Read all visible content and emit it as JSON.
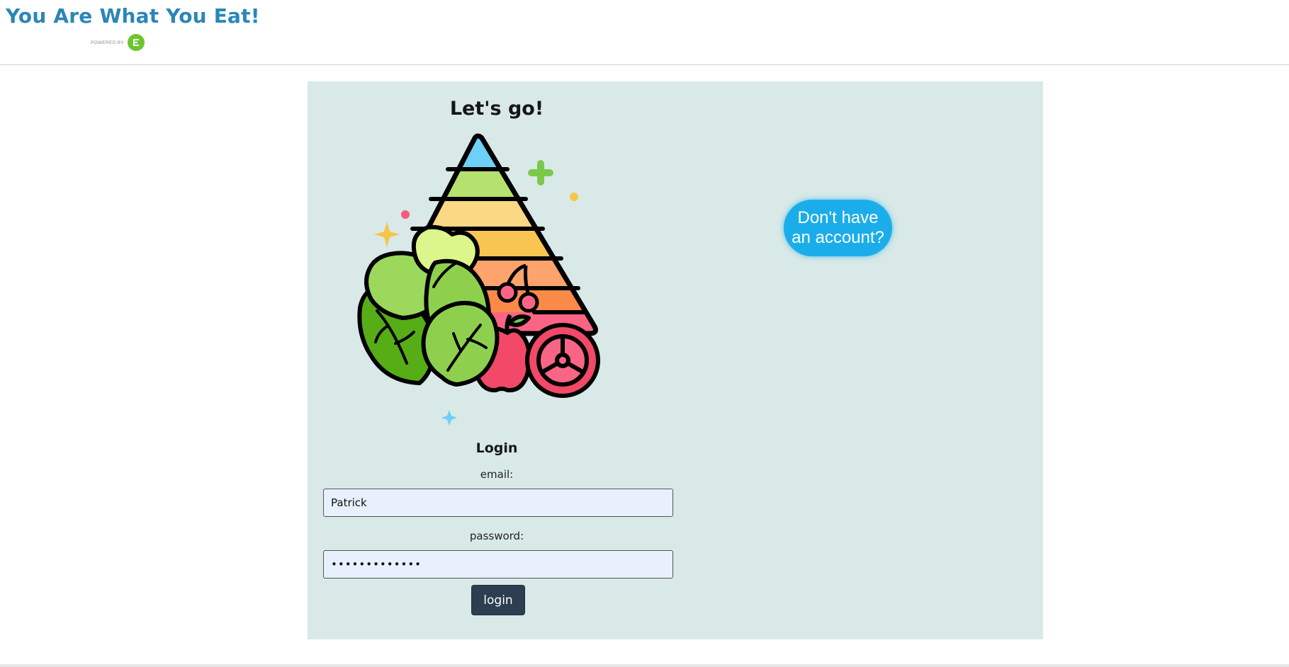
{
  "header": {
    "title": "You Are What You Eat!",
    "powered_by": "POWERED BY",
    "brand_logo_letter": "E",
    "brand_color": "#6bc72e",
    "title_color": "#2b86b7"
  },
  "main": {
    "heading": "Let's go!",
    "illustration": "food-pyramid-illustration",
    "login": {
      "title": "Login",
      "email_label": "email:",
      "email_value": "Patrick",
      "password_label": "password:",
      "password_value": "•••••••••••••",
      "submit_label": "login"
    },
    "signup_label": "Don't have an account?"
  },
  "colors": {
    "panel_background": "#d8e9e7",
    "signup_button": "#1badea",
    "login_button": "#2c3e50",
    "input_background": "#e8f0fd"
  }
}
